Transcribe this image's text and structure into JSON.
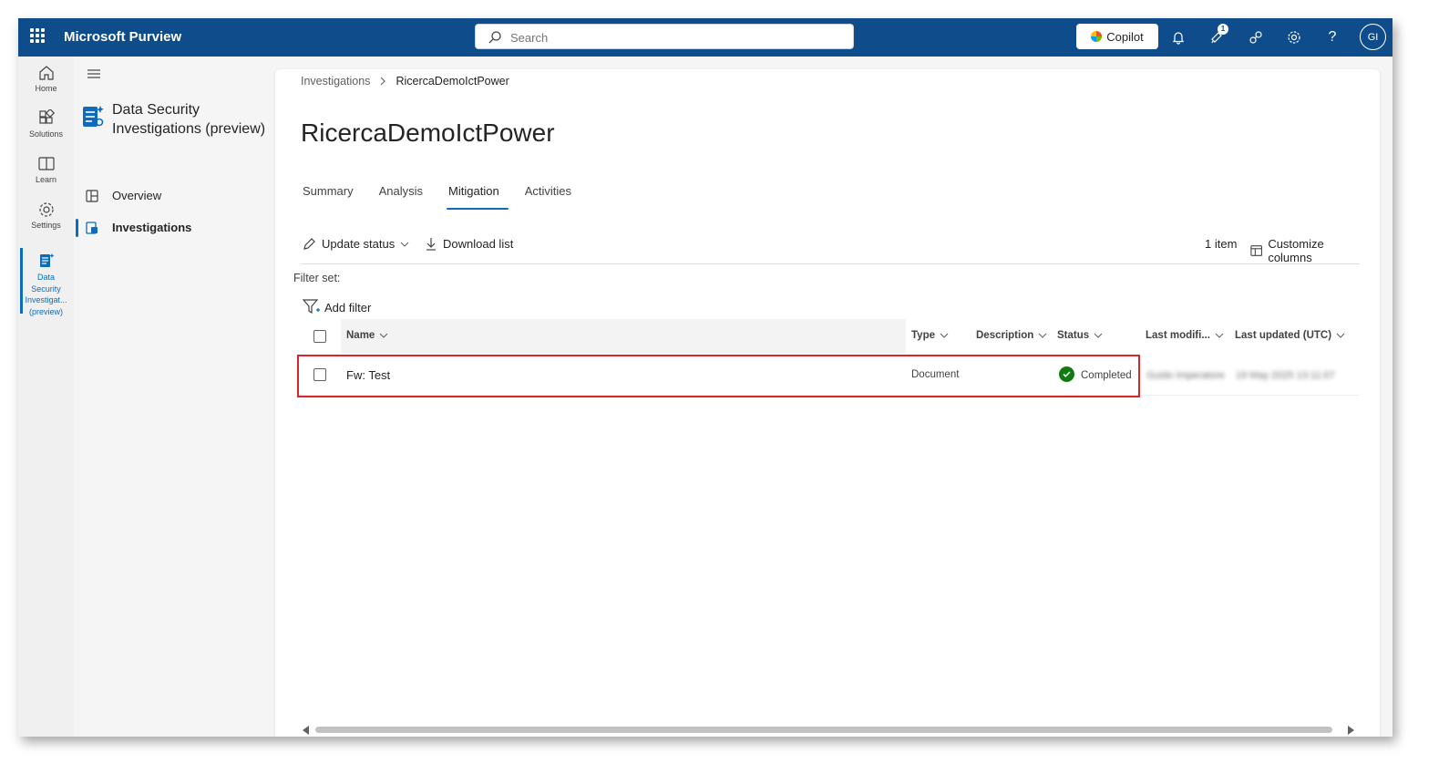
{
  "app": {
    "title": "Microsoft Purview",
    "search_placeholder": "Search",
    "copilot_label": "Copilot",
    "notification_count": "1",
    "avatar_initials": "GI"
  },
  "rail": {
    "items": [
      {
        "label": "Home",
        "icon": "home-icon"
      },
      {
        "label": "Solutions",
        "icon": "solutions-icon"
      },
      {
        "label": "Learn",
        "icon": "book-icon"
      },
      {
        "label": "Settings",
        "icon": "gear-icon"
      },
      {
        "label_lines": [
          "Data",
          "Security",
          "Investigat...",
          "(preview)"
        ],
        "icon": "data-security-icon"
      }
    ]
  },
  "nav": {
    "title": "Data Security Investigations (preview)",
    "items": [
      {
        "label": "Overview",
        "icon": "overview-icon"
      },
      {
        "label": "Investigations",
        "icon": "investigations-icon",
        "active": true
      }
    ]
  },
  "page": {
    "breadcrumb": [
      "Investigations",
      "RicercaDemoIctPower"
    ],
    "title": "RicercaDemoIctPower",
    "tabs": [
      "Summary",
      "Analysis",
      "Mitigation",
      "Activities"
    ],
    "active_tab": "Mitigation"
  },
  "toolbar": {
    "update_status": "Update status",
    "download_list": "Download list",
    "item_count": "1 item",
    "customize_columns": "Customize columns"
  },
  "filters": {
    "filter_set_label": "Filter set:",
    "add_filter": "Add filter"
  },
  "table": {
    "columns": [
      "Name",
      "Type",
      "Description",
      "Status",
      "Last modifi...",
      "Last updated (UTC)"
    ],
    "rows": [
      {
        "name": "Fw: Test",
        "type": "Document",
        "description": "",
        "status": "Completed",
        "last_modified": "Guido Imperatore",
        "last_updated": "19 May 2025 13:11:07"
      }
    ]
  },
  "colors": {
    "header_bg": "#0f4c8c",
    "accent": "#0f6cbd",
    "status_completed": "#107c10",
    "highlight_border": "#d8262c"
  }
}
